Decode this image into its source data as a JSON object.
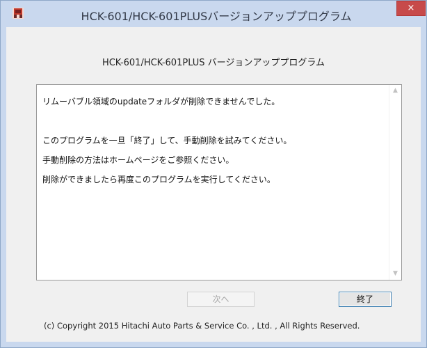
{
  "window": {
    "title": "HCK-601/HCK-601PLUSバージョンアッププログラム",
    "close_label": "×"
  },
  "dialog": {
    "heading": "HCK-601/HCK-601PLUS バージョンアッププログラム",
    "message_lines": [
      "リムーバブル領域のupdateフォルダが削除できませんでした。",
      "",
      "このプログラムを一旦「終了」して、手動削除を試みてください。",
      "手動削除の方法はホームページをご参照ください。",
      "削除ができましたら再度このプログラムを実行してください。"
    ],
    "scroll_up_glyph": "▲",
    "scroll_down_glyph": "▼",
    "next_label": "次へ",
    "exit_label": "終了",
    "copyright": "(c) Copyright 2015  Hitachi Auto Parts & Service Co. , Ltd. , All Rights Reserved."
  },
  "icons": {
    "app": "app-icon",
    "close": "close-icon"
  },
  "colors": {
    "titlebar": "#c9d8ee",
    "close_button": "#c74a4a",
    "client_background": "#f0f0f0",
    "focus_border": "#3c7fb1"
  }
}
